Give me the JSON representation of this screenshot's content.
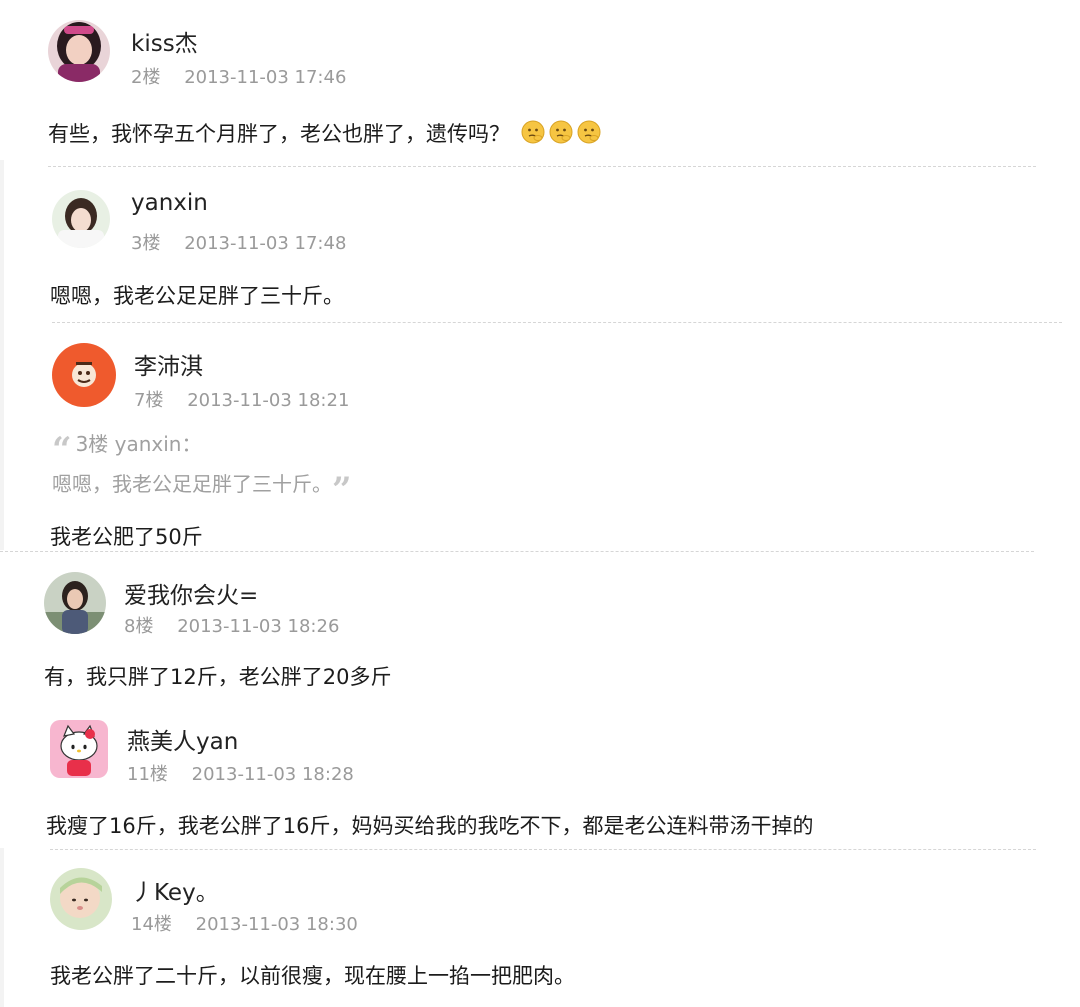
{
  "posts": [
    {
      "username": "kiss杰",
      "floor": "2楼",
      "timestamp": "2013-11-03 17:46",
      "content": "有些，我怀孕五个月胖了，老公也胖了，遗传吗？",
      "emojis": [
        "thinking-face-icon",
        "thinking-face-icon",
        "thinking-face-icon"
      ],
      "avatar": "user-avatar-girl-dark-hair"
    },
    {
      "username": "yanxin",
      "floor": "3楼",
      "timestamp": "2013-11-03 17:48",
      "content": "嗯嗯，我老公足足胖了三十斤。",
      "avatar": "user-avatar-girl-light"
    },
    {
      "username": "李沛淇",
      "floor": "7楼",
      "timestamp": "2013-11-03 18:21",
      "quote": {
        "source": "3楼 yanxin：",
        "text": "嗯嗯，我老公足足胖了三十斤。"
      },
      "content": "我老公肥了50斤",
      "avatar": "user-avatar-orange-badge"
    },
    {
      "username": "爱我你会火=",
      "floor": "8楼",
      "timestamp": "2013-11-03 18:26",
      "content": "有，我只胖了12斤，老公胖了20多斤",
      "avatar": "user-avatar-girl-outdoor"
    },
    {
      "username": "燕美人yan",
      "floor": "11楼",
      "timestamp": "2013-11-03 18:28",
      "content": "我瘦了16斤，我老公胖了16斤，妈妈买给我的我吃不下，都是老公连料带汤干掉的",
      "avatar": "user-avatar-hello-kitty"
    },
    {
      "username": "丿Key。",
      "floor": "14楼",
      "timestamp": "2013-11-03 18:30",
      "content": "我老公胖了二十斤，以前很瘦，现在腰上一掐一把肥肉。",
      "avatar": "user-avatar-baby"
    }
  ],
  "colors": {
    "text": "#1c1c1c",
    "meta": "#9a9a9a",
    "quote": "#a0a0a0",
    "badge_orange": "#ef5a2d"
  }
}
